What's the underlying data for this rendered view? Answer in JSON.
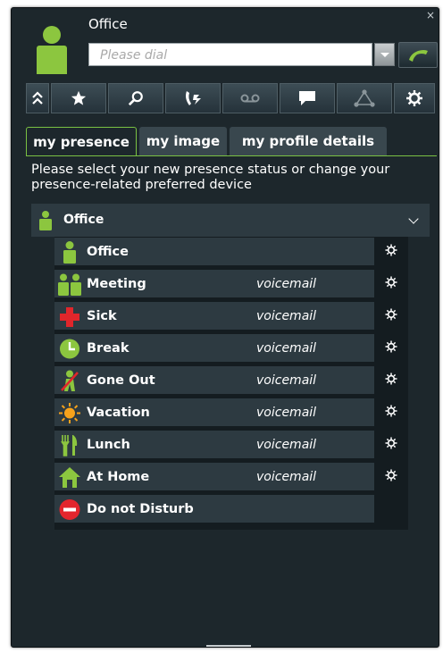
{
  "window": {
    "title": "Office",
    "close_symbol": "×"
  },
  "dial": {
    "placeholder": "Please dial"
  },
  "toolbar": {
    "buttons": [
      {
        "icon": "collapse-chevrons-icon"
      },
      {
        "icon": "star-icon"
      },
      {
        "icon": "search-icon"
      },
      {
        "icon": "call-forward-icon"
      },
      {
        "icon": "voicemail-icon"
      },
      {
        "icon": "chat-icon"
      },
      {
        "icon": "network-icon"
      },
      {
        "icon": "gear-icon"
      }
    ]
  },
  "tabs": [
    {
      "label": "my presence",
      "active": true
    },
    {
      "label": "my image",
      "active": false
    },
    {
      "label": "my profile details",
      "active": false
    }
  ],
  "intro_text": "Please select your new presence status or change your presence-related preferred device",
  "current_status": {
    "label": "Office",
    "icon": "office-person-icon"
  },
  "statuses": [
    {
      "label": "Office",
      "device": "",
      "icon": "office-person-icon"
    },
    {
      "label": "Meeting",
      "device": "voicemail",
      "icon": "meeting-people-icon"
    },
    {
      "label": "Sick",
      "device": "voicemail",
      "icon": "red-cross-icon"
    },
    {
      "label": "Break",
      "device": "voicemail",
      "icon": "clock-icon"
    },
    {
      "label": "Gone Out",
      "device": "voicemail",
      "icon": "gone-out-icon"
    },
    {
      "label": "Vacation",
      "device": "voicemail",
      "icon": "sun-icon"
    },
    {
      "label": "Lunch",
      "device": "voicemail",
      "icon": "fork-knife-icon"
    },
    {
      "label": "At Home",
      "device": "voicemail",
      "icon": "house-icon"
    },
    {
      "label": "Do not Disturb",
      "device": "",
      "icon": "do-not-disturb-icon"
    }
  ],
  "colors": {
    "accent": "#8cc63f",
    "panel": "#1d272c",
    "row": "#2d3a41",
    "sick": "#e0262b",
    "vacation": "#f7a21b",
    "dnd": "#e3252d"
  }
}
